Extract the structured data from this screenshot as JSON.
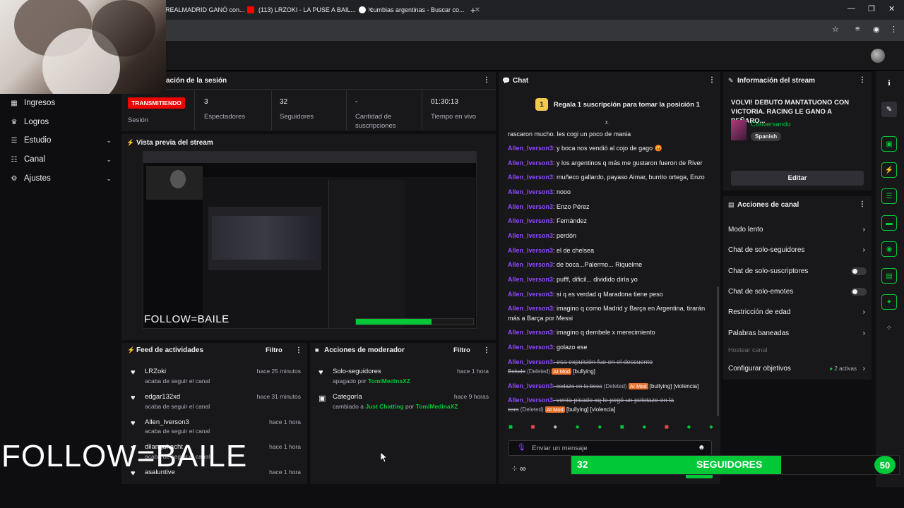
{
  "browser": {
    "tabs": [
      {
        "label": "REALMADRID GANÓ con..."
      },
      {
        "label": "(113) LRZOKI - LA PUSE A BAIL..."
      },
      {
        "label": "cumbias argentinas - Buscar co..."
      }
    ],
    "new_tab": "+"
  },
  "sidebar": {
    "items": [
      {
        "label": "Ingresos",
        "icon": "bank-icon"
      },
      {
        "label": "Logros",
        "icon": "trophy-icon"
      },
      {
        "label": "Estudio",
        "icon": "studio-icon"
      },
      {
        "label": "Canal",
        "icon": "list-icon"
      },
      {
        "label": "Ajustes",
        "icon": "gear-icon"
      }
    ]
  },
  "session": {
    "title": "ación de la sesión",
    "live_badge": "TRANSMITIENDO",
    "session_label": "Sesión",
    "stats": [
      {
        "value": "3",
        "label": "Espectadores"
      },
      {
        "value": "32",
        "label": "Seguidores"
      },
      {
        "value": "-",
        "label": "Cantidad de suscripciones"
      },
      {
        "value": "01:30:13",
        "label": "Tiempo en vivo"
      }
    ]
  },
  "preview": {
    "title": "Vista previa del stream",
    "overlay_text": "FOLLOW=BAILE"
  },
  "feed": {
    "title": "Feed de actividades",
    "filter": "Filtro",
    "items": [
      {
        "name": "LRZoki",
        "sub": "acaba de seguir el canal",
        "time": "hace 25 minutos"
      },
      {
        "name": "edgar132xd",
        "sub": "acaba de seguir el canal",
        "time": "hace 31 minutos"
      },
      {
        "name": "Allen_Iverson3",
        "sub": "acaba de seguir el canal",
        "time": "hace 1 hora"
      },
      {
        "name": "dilanguhacht",
        "sub": "acaba de seguir el canal",
        "time": "hace 1 hora"
      },
      {
        "name": "asaluntive",
        "sub": "",
        "time": "hace 1 hora"
      }
    ]
  },
  "mod_actions": {
    "title": "Acciones de moderador",
    "filter": "Filtro",
    "items": [
      {
        "title": "Solo-seguidores",
        "detail_prefix": "apagado por",
        "detail_user": "TomiMedinaXZ",
        "time": "hace 1 hora"
      },
      {
        "title": "Categoría",
        "detail_prefix": "cambiado a",
        "detail_game": "Just Chatting",
        "detail_mid": "por",
        "detail_user": "TomiMedinaXZ",
        "time": "hace 9 horas"
      }
    ]
  },
  "chat": {
    "title": "Chat",
    "pinned": "Regala 1 suscripción para tomar la posición 1",
    "rank": "1",
    "messages": [
      {
        "user": "",
        "text": "rascaron mucho. les cogi un poco de mania"
      },
      {
        "user": "Allen_Iverson3",
        "text": ": y boca nos vendió al cojo de gago 😡"
      },
      {
        "user": "Allen_Iverson3",
        "text": ": y los argentinos q más me gustaron fueron de River"
      },
      {
        "user": "Allen_Iverson3",
        "text": ": muñeco gallardo, payaso Aimar, burrito ortega, Enzo"
      },
      {
        "user": "Allen_Iverson3",
        "text": ": nooo"
      },
      {
        "user": "Allen_Iverson3",
        "text": ": Enzo Pérez"
      },
      {
        "user": "Allen_Iverson3",
        "text": ": Fernández"
      },
      {
        "user": "Allen_Iverson3",
        "text": ": perdón"
      },
      {
        "user": "Allen_Iverson3",
        "text": ": el de chelsea"
      },
      {
        "user": "Allen_Iverson3",
        "text": ": de boca...Palermo... Riquelme"
      },
      {
        "user": "Allen_Iverson3",
        "text": ": pufff, dificil... dividido diría yo"
      },
      {
        "user": "Allen_Iverson3",
        "text": ": si q es verdad q Maradona tiene peso"
      },
      {
        "user": "Allen_Iverson3",
        "text": ": imagino q como Madrid y Barça en Argentina, tirarán"
      },
      {
        "user": "",
        "text": "más a Barça por Messi"
      },
      {
        "user": "Allen_Iverson3",
        "text": ": imagino q dembele x merecimiento"
      },
      {
        "user": "Allen_Iverson3",
        "text": ": golazo ese"
      }
    ],
    "deleted": [
      {
        "user": "Allen_Iverson3",
        "text": ": esa expulsión fue en el descuento",
        "cont": "Boludo",
        "tag": "(Deleted)",
        "mod": "AI Mod",
        "reasons": "[bullying]"
      },
      {
        "user": "Allen_Iverson3",
        "text": ": codazo en la boca",
        "tag": "(Deleted)",
        "mod": "AI Mod",
        "reasons": "[bullying] [violencia]"
      },
      {
        "user": "Allen_Iverson3",
        "text": ": venía picado xq le pegó un pelotazo en la",
        "cont": "cara",
        "tag": "(Deleted)",
        "mod": "AI Mod",
        "reasons": "[bullying] [violencia]"
      }
    ],
    "input_placeholder": "Enviar un mensaje",
    "footer_icon": "∞"
  },
  "stream_info": {
    "title": "Información del stream",
    "stream_title": "VOLVI! DEBUTO MANTATUONO CON VICTORIA. RACING LE GANO A PEÑARO...",
    "category": "Conversando",
    "tag": "Spanish",
    "edit_button": "Editar"
  },
  "channel_actions": {
    "title": "Acciones de canal",
    "items": [
      {
        "label": "Modo lento",
        "control": "chevron"
      },
      {
        "label": "Chat de solo-seguidores",
        "control": "chevron"
      },
      {
        "label": "Chat de solo-suscriptores",
        "control": "toggle"
      },
      {
        "label": "Chat de solo-emotes",
        "control": "toggle"
      },
      {
        "label": "Restricción de edad",
        "control": "chevron"
      },
      {
        "label": "Palabras baneadas",
        "control": "chevron"
      },
      {
        "label": "Hostear canal",
        "control": "disabled"
      },
      {
        "label": "Configurar objetivos",
        "control": "chevron",
        "extra": "2 activas"
      }
    ]
  },
  "overlay": {
    "follow_text": "FOLLOW=BAILE",
    "followers_count": "32",
    "followers_label": "SEGUIDORES",
    "goal": "50",
    "progress": 0.64
  },
  "colors": {
    "accent": "#9147ff",
    "live_red": "#eb0400",
    "green": "#00c837",
    "panel": "#18181b",
    "bg": "#0e0e10"
  }
}
